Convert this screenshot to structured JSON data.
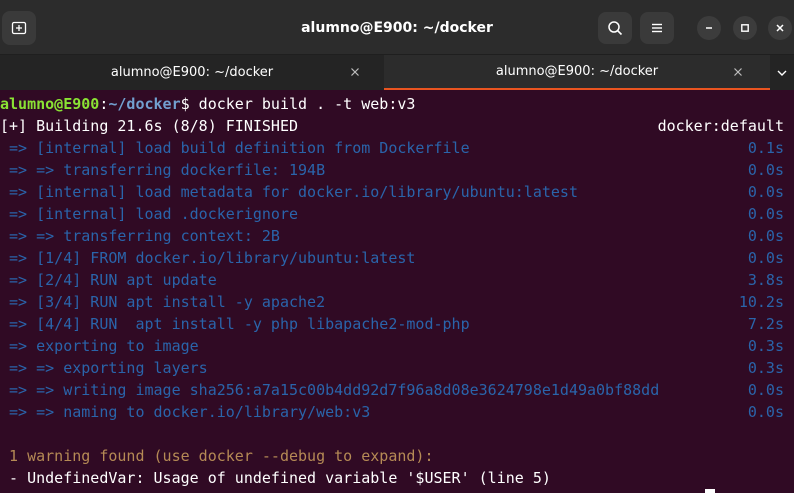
{
  "window": {
    "title": "alumno@E900: ~/docker"
  },
  "tabs": [
    {
      "label": "alumno@E900: ~/docker",
      "active": false
    },
    {
      "label": "alumno@E900: ~/docker",
      "active": true
    }
  ],
  "icons": {
    "new_tab": "new-tab-icon",
    "search": "search-icon",
    "menu": "hamburger-menu-icon",
    "minimize": "minimize-icon",
    "maximize": "maximize-icon",
    "close": "close-icon",
    "tab_close": "close-icon",
    "tab_menu": "chevron-down-icon"
  },
  "colors": {
    "terminal_bg": "#300a24",
    "prompt_user": "#8ae234",
    "prompt_path": "#729fcf",
    "step_text": "#2a64aa",
    "warning_text": "#b58a55",
    "active_tab_indicator": "#e95420"
  },
  "terminal": {
    "prompt": {
      "user_host": "alumno@E900",
      "sep": ":",
      "path": "~/docker",
      "symbol": "$",
      "command": " docker build . -t web:v3"
    },
    "header": {
      "left": "[+] Building 21.6s (8/8) FINISHED",
      "right": "docker:default"
    },
    "steps": [
      {
        "text": " => [internal] load build definition from Dockerfile",
        "time": "0.1s"
      },
      {
        "text": " => => transferring dockerfile: 194B",
        "time": "0.0s"
      },
      {
        "text": " => [internal] load metadata for docker.io/library/ubuntu:latest",
        "time": "0.0s"
      },
      {
        "text": " => [internal] load .dockerignore",
        "time": "0.0s"
      },
      {
        "text": " => => transferring context: 2B",
        "time": "0.0s"
      },
      {
        "text": " => [1/4] FROM docker.io/library/ubuntu:latest",
        "time": "0.0s"
      },
      {
        "text": " => [2/4] RUN apt update",
        "time": "3.8s"
      },
      {
        "text": " => [3/4] RUN apt install -y apache2",
        "time": "10.2s"
      },
      {
        "text": " => [4/4] RUN  apt install -y php libapache2-mod-php",
        "time": "7.2s"
      },
      {
        "text": " => exporting to image",
        "time": "0.3s"
      },
      {
        "text": " => => exporting layers",
        "time": "0.3s"
      },
      {
        "text": " => => writing image sha256:a7a15c00b4dd92d7f96a8d08e3624798e1d49a0bf88dd",
        "time": "0.0s"
      },
      {
        "text": " => => naming to docker.io/library/web:v3",
        "time": "0.0s"
      }
    ],
    "warning": " 1 warning found (use docker --debug to expand):",
    "warning_detail": " - UndefinedVar: Usage of undefined variable '$USER' (line 5)"
  }
}
